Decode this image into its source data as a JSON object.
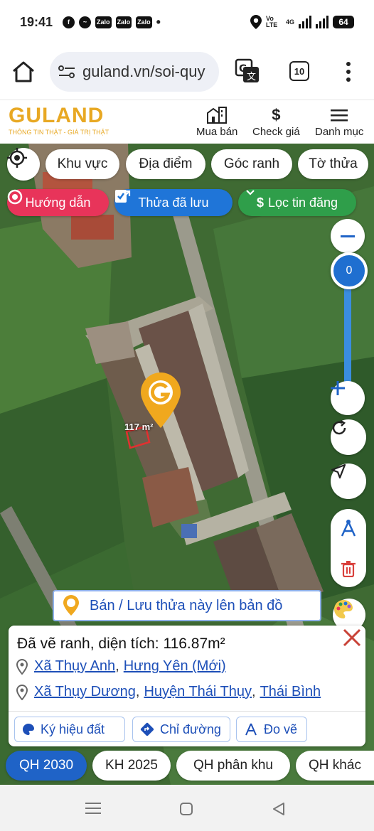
{
  "status_bar": {
    "time": "19:41",
    "app_icons": [
      "facebook-icon",
      "messenger-icon",
      "Zalo",
      "Zalo",
      "Zalo"
    ],
    "network_label": "Vo LTE",
    "network_gen": "4G",
    "battery": "64"
  },
  "browser": {
    "url": "guland.vn/soi-quy",
    "tab_count": "10"
  },
  "site": {
    "logo_text": "GULAND",
    "logo_tagline": "THÔNG TIN THẬT - GIÁ TRỊ THẬT",
    "nav": [
      {
        "label": "Mua bán",
        "icon": "building-icon"
      },
      {
        "label": "Check giá",
        "icon": "dollar-icon"
      },
      {
        "label": "Danh mục",
        "icon": "menu-icon"
      }
    ]
  },
  "filters": {
    "row1": [
      "Khu vực",
      "Địa điểm",
      "Góc ranh",
      "Tờ thửa"
    ],
    "guide_label": "Hướng dẫn",
    "saved_label": "Thửa đã lưu",
    "filter_label": "Lọc tin đăng"
  },
  "map": {
    "zoom_value": "0",
    "marker_label": "117 m²",
    "accent_color": "#1f63c7",
    "marker_color": "#f0a81e"
  },
  "banner": {
    "label": "Bán / Lưu thửa này lên bản đồ"
  },
  "panel": {
    "title": "Đã vẽ ranh, diện tích: 116.87m²",
    "location_new": [
      "Xã Thụy Anh",
      "Hưng Yên (Mới)"
    ],
    "location_old": [
      "Xã Thụy Dương",
      "Huyện Thái Thụy",
      "Thái Bình"
    ],
    "buttons": [
      "Ký hiệu đất",
      "Chỉ đường",
      "Đo vẽ"
    ]
  },
  "bottom_tabs": [
    "QH 2030",
    "KH 2025",
    "QH phân khu",
    "QH khác"
  ]
}
